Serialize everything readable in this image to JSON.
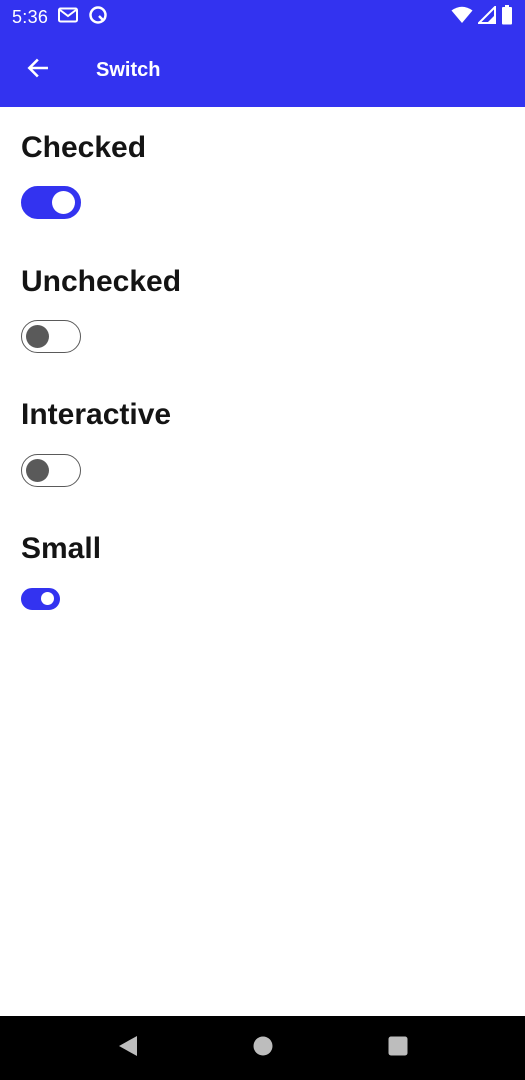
{
  "status_bar": {
    "time": "5:36",
    "left_icons": [
      "gmail-icon",
      "sync-icon"
    ],
    "right_icons": [
      "wifi-icon",
      "cell-signal-icon",
      "battery-icon"
    ]
  },
  "app_bar": {
    "title": "Switch",
    "back_icon": "arrow-back-icon",
    "color": "#3333f0"
  },
  "sections": [
    {
      "heading": "Checked",
      "checked": true,
      "size": "large"
    },
    {
      "heading": "Unchecked",
      "checked": false,
      "size": "large"
    },
    {
      "heading": "Interactive",
      "checked": false,
      "size": "large"
    },
    {
      "heading": "Small",
      "checked": true,
      "size": "small"
    }
  ],
  "nav_bar": {
    "buttons": [
      "back-triangle-icon",
      "home-circle-icon",
      "recents-square-icon"
    ]
  },
  "colors": {
    "accent": "#3333f0",
    "switch_off": "#5a5a5a",
    "heading": "#141414"
  }
}
